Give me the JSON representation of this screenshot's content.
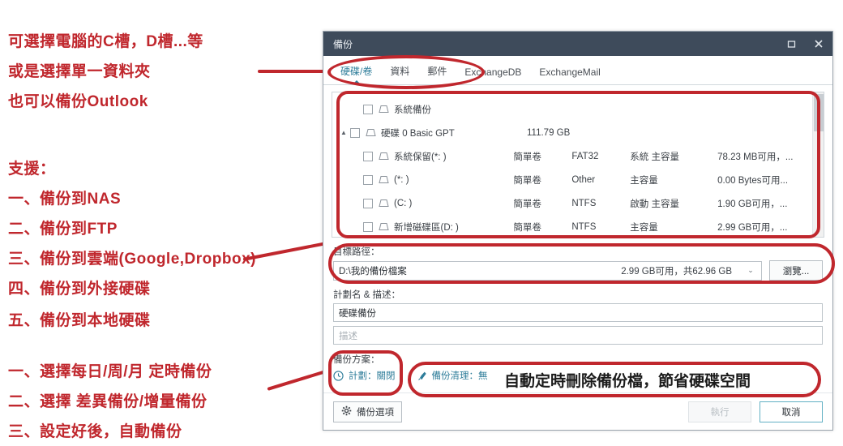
{
  "annotations": {
    "lines": [
      "可選擇電腦的C槽，D槽...等",
      "或是選擇單一資料夾",
      "也可以備份Outlook",
      "支援：",
      "一、備份到NAS",
      "二、備份到FTP",
      "三、備份到雲端(Google,Dropbox)",
      "四、備份到外接硬碟",
      "五、備份到本地硬碟",
      "一、選擇每日/周/月 定時備份",
      "二、選擇 差異備份/增量備份",
      "三、設定好後，自動備份"
    ],
    "callout": "自動定時刪除備份檔，節省硬碟空間",
    "color": "#c0272d"
  },
  "dialog": {
    "title": "備份",
    "titlebar_color": "#3e4b5b",
    "accent_color": "#2e7d9a",
    "window_buttons": [
      {
        "name": "maximize",
        "label": "▢"
      },
      {
        "name": "close",
        "label": "✕"
      }
    ],
    "tabs": [
      {
        "label": "硬碟/卷",
        "active": true
      },
      {
        "label": "資料",
        "active": false
      },
      {
        "label": "郵件",
        "active": false
      },
      {
        "label": "ExchangeDB",
        "active": false
      },
      {
        "label": "ExchangeMail",
        "active": false
      }
    ],
    "tree": {
      "rows": [
        {
          "indent": 1,
          "expander": "",
          "checked": false,
          "name": "系統備份",
          "size": "",
          "type": "",
          "fs": "",
          "role": "",
          "free": ""
        },
        {
          "indent": 0,
          "expander": "▲",
          "checked": false,
          "name": "硬碟 0 Basic GPT",
          "size": "111.79 GB",
          "type": "",
          "fs": "",
          "role": "",
          "free": ""
        },
        {
          "indent": 2,
          "expander": "",
          "checked": false,
          "name": "系統保留(*: )",
          "size": "",
          "type": "簡單卷",
          "fs": "FAT32",
          "role": "系統 主容量",
          "free": "78.23 MB可用，..."
        },
        {
          "indent": 2,
          "expander": "",
          "checked": false,
          "name": "(*: )",
          "size": "",
          "type": "簡單卷",
          "fs": "Other",
          "role": "主容量",
          "free": "0.00 Bytes可用..."
        },
        {
          "indent": 2,
          "expander": "",
          "checked": false,
          "name": "(C: )",
          "size": "",
          "type": "簡單卷",
          "fs": "NTFS",
          "role": "啟動 主容量",
          "free": "1.90 GB可用，..."
        },
        {
          "indent": 2,
          "expander": "",
          "checked": false,
          "name": "新增磁碟區(D: )",
          "size": "",
          "type": "簡單卷",
          "fs": "NTFS",
          "role": "主容量",
          "free": "2.99 GB可用，..."
        }
      ]
    },
    "target_path": {
      "label": "目標路徑：",
      "value": "D:\\我的備份檔案",
      "capacity": "2.99 GB可用，共62.96 GB",
      "browse_label": "瀏覽..."
    },
    "plan_name": {
      "label": "計劃名 & 描述：",
      "value": "硬碟備份",
      "description_placeholder": "描述",
      "description_value": ""
    },
    "backup_plan": {
      "label": "備份方案：",
      "schedule": "計劃：關閉",
      "cleanup": "備份清理：無"
    },
    "footer": {
      "options_label": "備份選項",
      "run_label": "執行",
      "cancel_label": "取消"
    }
  }
}
